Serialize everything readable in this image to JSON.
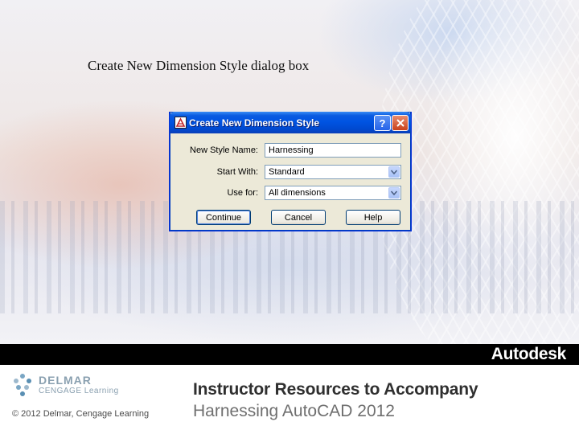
{
  "slide": {
    "title": "Create New Dimension Style dialog box"
  },
  "dialog": {
    "title": "Create New Dimension Style",
    "help_glyph": "?",
    "fields": {
      "new_style_name_label": "New Style Name:",
      "new_style_name_value": "Harnessing",
      "start_with_label": "Start With:",
      "start_with_value": "Standard",
      "use_for_label": "Use for:",
      "use_for_value": "All dimensions"
    },
    "buttons": {
      "continue": "Continue",
      "cancel": "Cancel",
      "help": "Help"
    }
  },
  "footer": {
    "brand": "Autodesk",
    "publisher_name": "DELMAR",
    "publisher_sub": "CENGAGE Learning",
    "copyright": "© 2012 Delmar, Cengage Learning",
    "line1": "Instructor Resources to Accompany",
    "line2": "Harnessing AutoCAD 2012"
  },
  "colors": {
    "titlebar": "#0054e3",
    "dialog_face": "#ece9d8",
    "footer_band": "#000000"
  }
}
